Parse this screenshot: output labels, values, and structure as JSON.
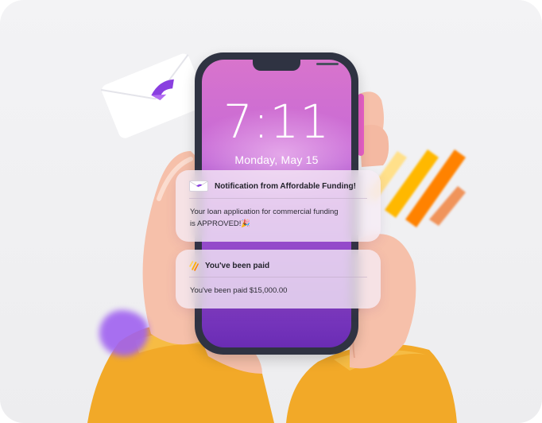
{
  "lockscreen": {
    "time": "7:11",
    "date": "Monday, May 15"
  },
  "notifications": [
    {
      "icon": "envelope-logo-icon",
      "title": "Notification from Affordable Funding!",
      "body_line1": "Your loan application for commercial funding",
      "body_line2": "is APPROVED!🎉"
    },
    {
      "icon": "stripes-logo-icon",
      "title": "You've been paid",
      "body_line1": "You've been paid $15,000.00"
    }
  ],
  "colors": {
    "brand_purple": "#8a3fe0",
    "stripe_orange": "#ff8a00",
    "stripe_yellow": "#ffc200",
    "hand_skin": "#f8c8b4",
    "sleeve": "#f2a928",
    "phone_body": "#2f3342"
  }
}
